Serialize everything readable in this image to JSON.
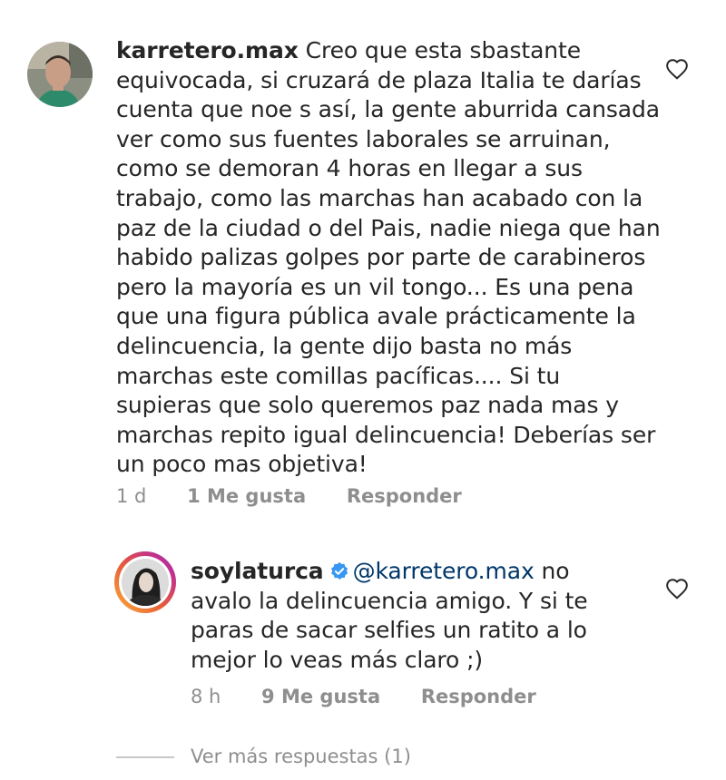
{
  "comment1": {
    "username": "karretero.max",
    "text": "Creo que esta sbastante equivocada, si cruzará de plaza Italia te darías cuenta que noe s así, la gente aburrida cansada ver como sus fuentes laborales se arruinan, como se demoran 4 horas en llegar a sus trabajo, como las marchas han acabado con la paz de la ciudad o del Pais, nadie niega que han habido palizas golpes por parte de carabineros pero la mayoría es un vil tongo... Es una pena que una figura pública avale prácticamente la delincuencia, la gente dijo basta no más marchas este comillas pacíficas.... Si tu supieras que solo queremos paz nada mas y marchas repito igual delincuencia! Deberías ser un poco mas objetiva!",
    "time": "1 d",
    "likes": "1 Me gusta",
    "reply_label": "Responder"
  },
  "comment2": {
    "username": "soylaturca",
    "mention": "@karretero.max",
    "text": " no avalo la delincuencia amigo. Y si te paras de sacar selfies un ratito a lo mejor lo veas más claro ;)",
    "time": "8 h",
    "likes": "9 Me gusta",
    "reply_label": "Responder"
  },
  "more_replies": "Ver más respuestas (1)",
  "colors": {
    "text": "#262626",
    "secondary": "#8e8e8e",
    "mention": "#00376b",
    "verified": "#3897f0"
  },
  "icons": [
    "heart-icon",
    "verified-badge-icon"
  ]
}
